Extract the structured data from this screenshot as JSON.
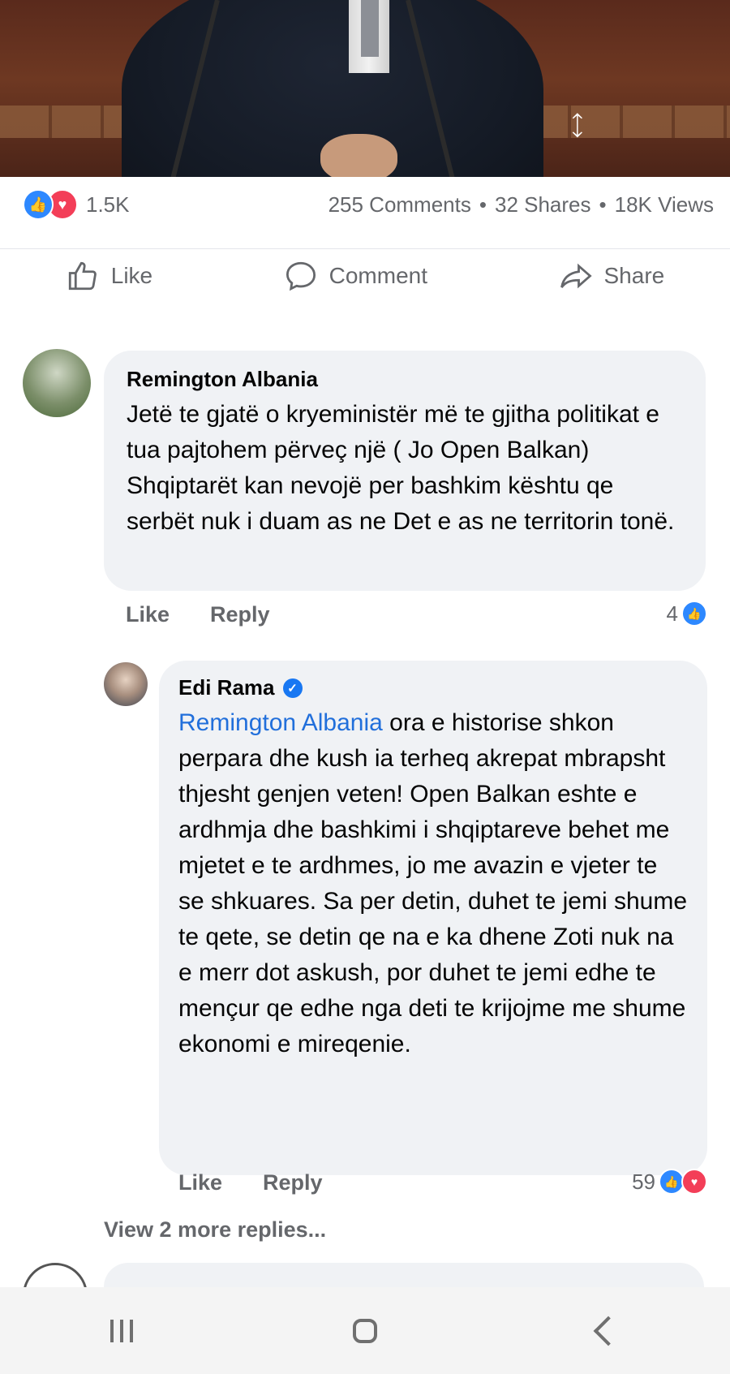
{
  "post": {
    "reactions_count": "1.5K",
    "comments": "255 Comments",
    "shares": "32 Shares",
    "views": "18K Views",
    "separator": "•"
  },
  "actions": {
    "like": "Like",
    "comment": "Comment",
    "share": "Share"
  },
  "comments": [
    {
      "author": "Remington Albania",
      "text": "Jetë te gjatë o kryeministër më te gjitha politikat e tua pajtohem përveç një ( Jo Open Balkan)  Shqiptarët kan nevojë per bashkim kështu qe serbët nuk i duam as ne Det e as ne territorin  tonë.",
      "like_label": "Like",
      "reply_label": "Reply",
      "reaction_count": "4"
    },
    {
      "author": "Edi Rama",
      "verified": true,
      "mention": "Remington Albania",
      "text": " ora e historise shkon perpara dhe kush ia terheq akrepat mbrapsht thjesht genjen veten! Open Balkan eshte e ardhmja dhe bashkimi i shqiptareve behet me mjetet e te ardhmes, jo me avazin e vjeter te se shkuares. Sa per detin, duhet te jemi shume te qete, se detin qe na e ka dhene Zoti nuk na e merr dot askush, por duhet te jemi edhe te mençur qe edhe nga deti te krijojme me shume ekonomi e mireqenie.",
      "like_label": "Like",
      "reply_label": "Reply",
      "reaction_count": "59"
    }
  ],
  "view_more": "View 2 more replies...",
  "colors": {
    "like_blue": "#2d88ff",
    "love_red": "#f33e58",
    "mention_blue": "#216fdb",
    "bubble_bg": "#f0f2f5",
    "meta_gray": "#65676b"
  },
  "icons": {
    "like": "thumbs-up-icon",
    "comment": "speech-bubble-icon",
    "share": "share-arrow-icon",
    "verified": "verified-badge-icon"
  }
}
